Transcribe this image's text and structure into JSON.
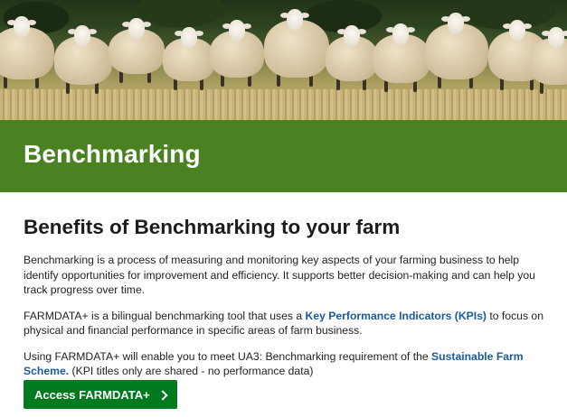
{
  "banner": {
    "title": "Benchmarking"
  },
  "section": {
    "heading": "Benefits of Benchmarking to your farm",
    "p1": "Benchmarking is a process of measuring and monitoring key aspects of your farming business to help identify opportunities for improvement and efficiency. It supports better decision-making and can help you track progress over time.",
    "p2_before": "FARMDATA+ is a bilingual benchmarking tool that uses a ",
    "p2_link": "Key Performance Indicators (KPIs)",
    "p2_after": " to focus on physical and financial performance in specific areas of farm business.",
    "p3_before": "Using FARMDATA+ will enable you to meet UA3: Benchmarking requirement of the ",
    "p3_link": "Sustainable Farm Scheme.",
    "p3_after": " (KPI titles only are shared - no performance data)"
  },
  "cta": {
    "label": "Access FARMDATA+",
    "icon": "chevron-right-icon"
  },
  "colors": {
    "banner": "#4a8222",
    "button": "#007a1f",
    "link": "#1a5a9c"
  }
}
